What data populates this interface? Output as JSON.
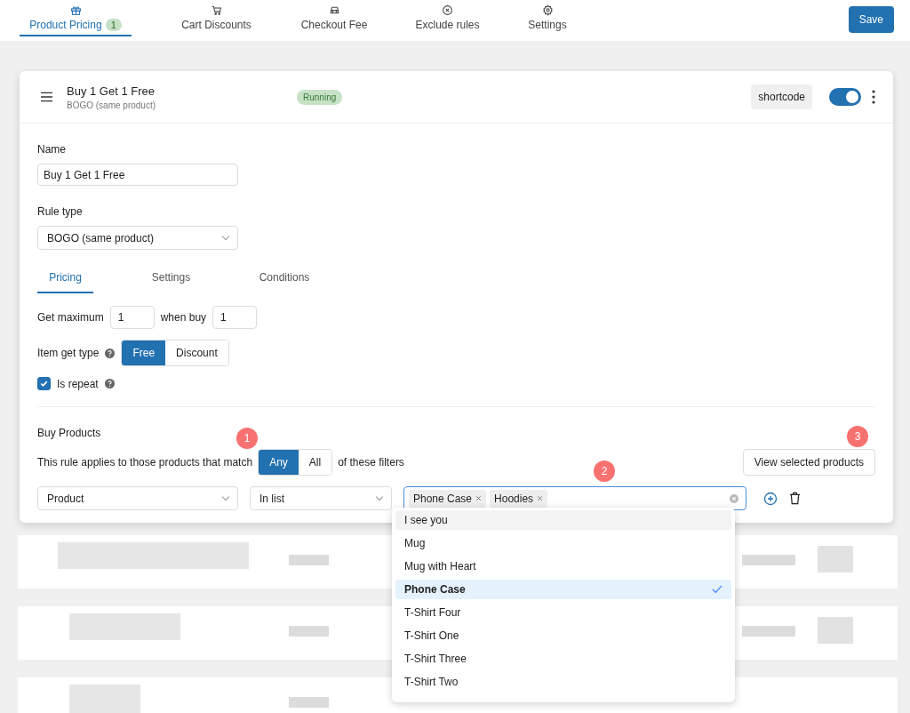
{
  "tabs": [
    {
      "label": "Product Pricing",
      "badge": "1",
      "selected": true
    },
    {
      "label": "Cart Discounts",
      "selected": false
    },
    {
      "label": "Checkout Fee",
      "selected": false
    },
    {
      "label": "Exclude rules",
      "selected": false
    },
    {
      "label": "Settings",
      "selected": false
    }
  ],
  "save_button": "Save",
  "rule": {
    "title": "Buy 1 Get 1 Free",
    "subtitle": "BOGO (same product)",
    "status": "Running",
    "shortcode": "shortcode",
    "enabled": true
  },
  "form": {
    "name_label": "Name",
    "name_value": "Buy 1 Get 1 Free",
    "rule_type_label": "Rule type",
    "rule_type_value": "BOGO (same product)"
  },
  "subtabs": [
    {
      "label": "Pricing",
      "selected": true
    },
    {
      "label": "Settings",
      "selected": false
    },
    {
      "label": "Conditions",
      "selected": false
    }
  ],
  "pricing": {
    "get_max_label": "Get maximum",
    "get_max_value": "1",
    "when_buy_label": "when buy",
    "when_buy_value": "1",
    "item_get_type_label": "Item get type",
    "item_get_type_options": [
      {
        "label": "Free",
        "selected": true
      },
      {
        "label": "Discount",
        "selected": false
      }
    ],
    "is_repeat": {
      "label": "Is repeat",
      "checked": true
    }
  },
  "buy_products": {
    "title": "Buy Products",
    "match_text": "This rule applies to those products that match",
    "match_options": [
      {
        "label": "Any",
        "selected": true
      },
      {
        "label": "All",
        "selected": false
      }
    ],
    "match_suffix": "of these filters",
    "view_button": "View selected products",
    "filter": {
      "field": "Product",
      "operator": "In list",
      "tags": [
        "Phone Case",
        "Hoodies"
      ]
    }
  },
  "dropdown": {
    "options": [
      {
        "label": "I see you",
        "highlighted": true,
        "selected": false
      },
      {
        "label": "Mug",
        "highlighted": false,
        "selected": false
      },
      {
        "label": "Mug with Heart",
        "highlighted": false,
        "selected": false
      },
      {
        "label": "Phone Case",
        "highlighted": false,
        "selected": true
      },
      {
        "label": "T-Shirt Four",
        "highlighted": false,
        "selected": false
      },
      {
        "label": "T-Shirt One",
        "highlighted": false,
        "selected": false
      },
      {
        "label": "T-Shirt Three",
        "highlighted": false,
        "selected": false
      },
      {
        "label": "T-Shirt Two",
        "highlighted": false,
        "selected": false
      }
    ]
  },
  "callouts": [
    "1",
    "2",
    "3"
  ]
}
